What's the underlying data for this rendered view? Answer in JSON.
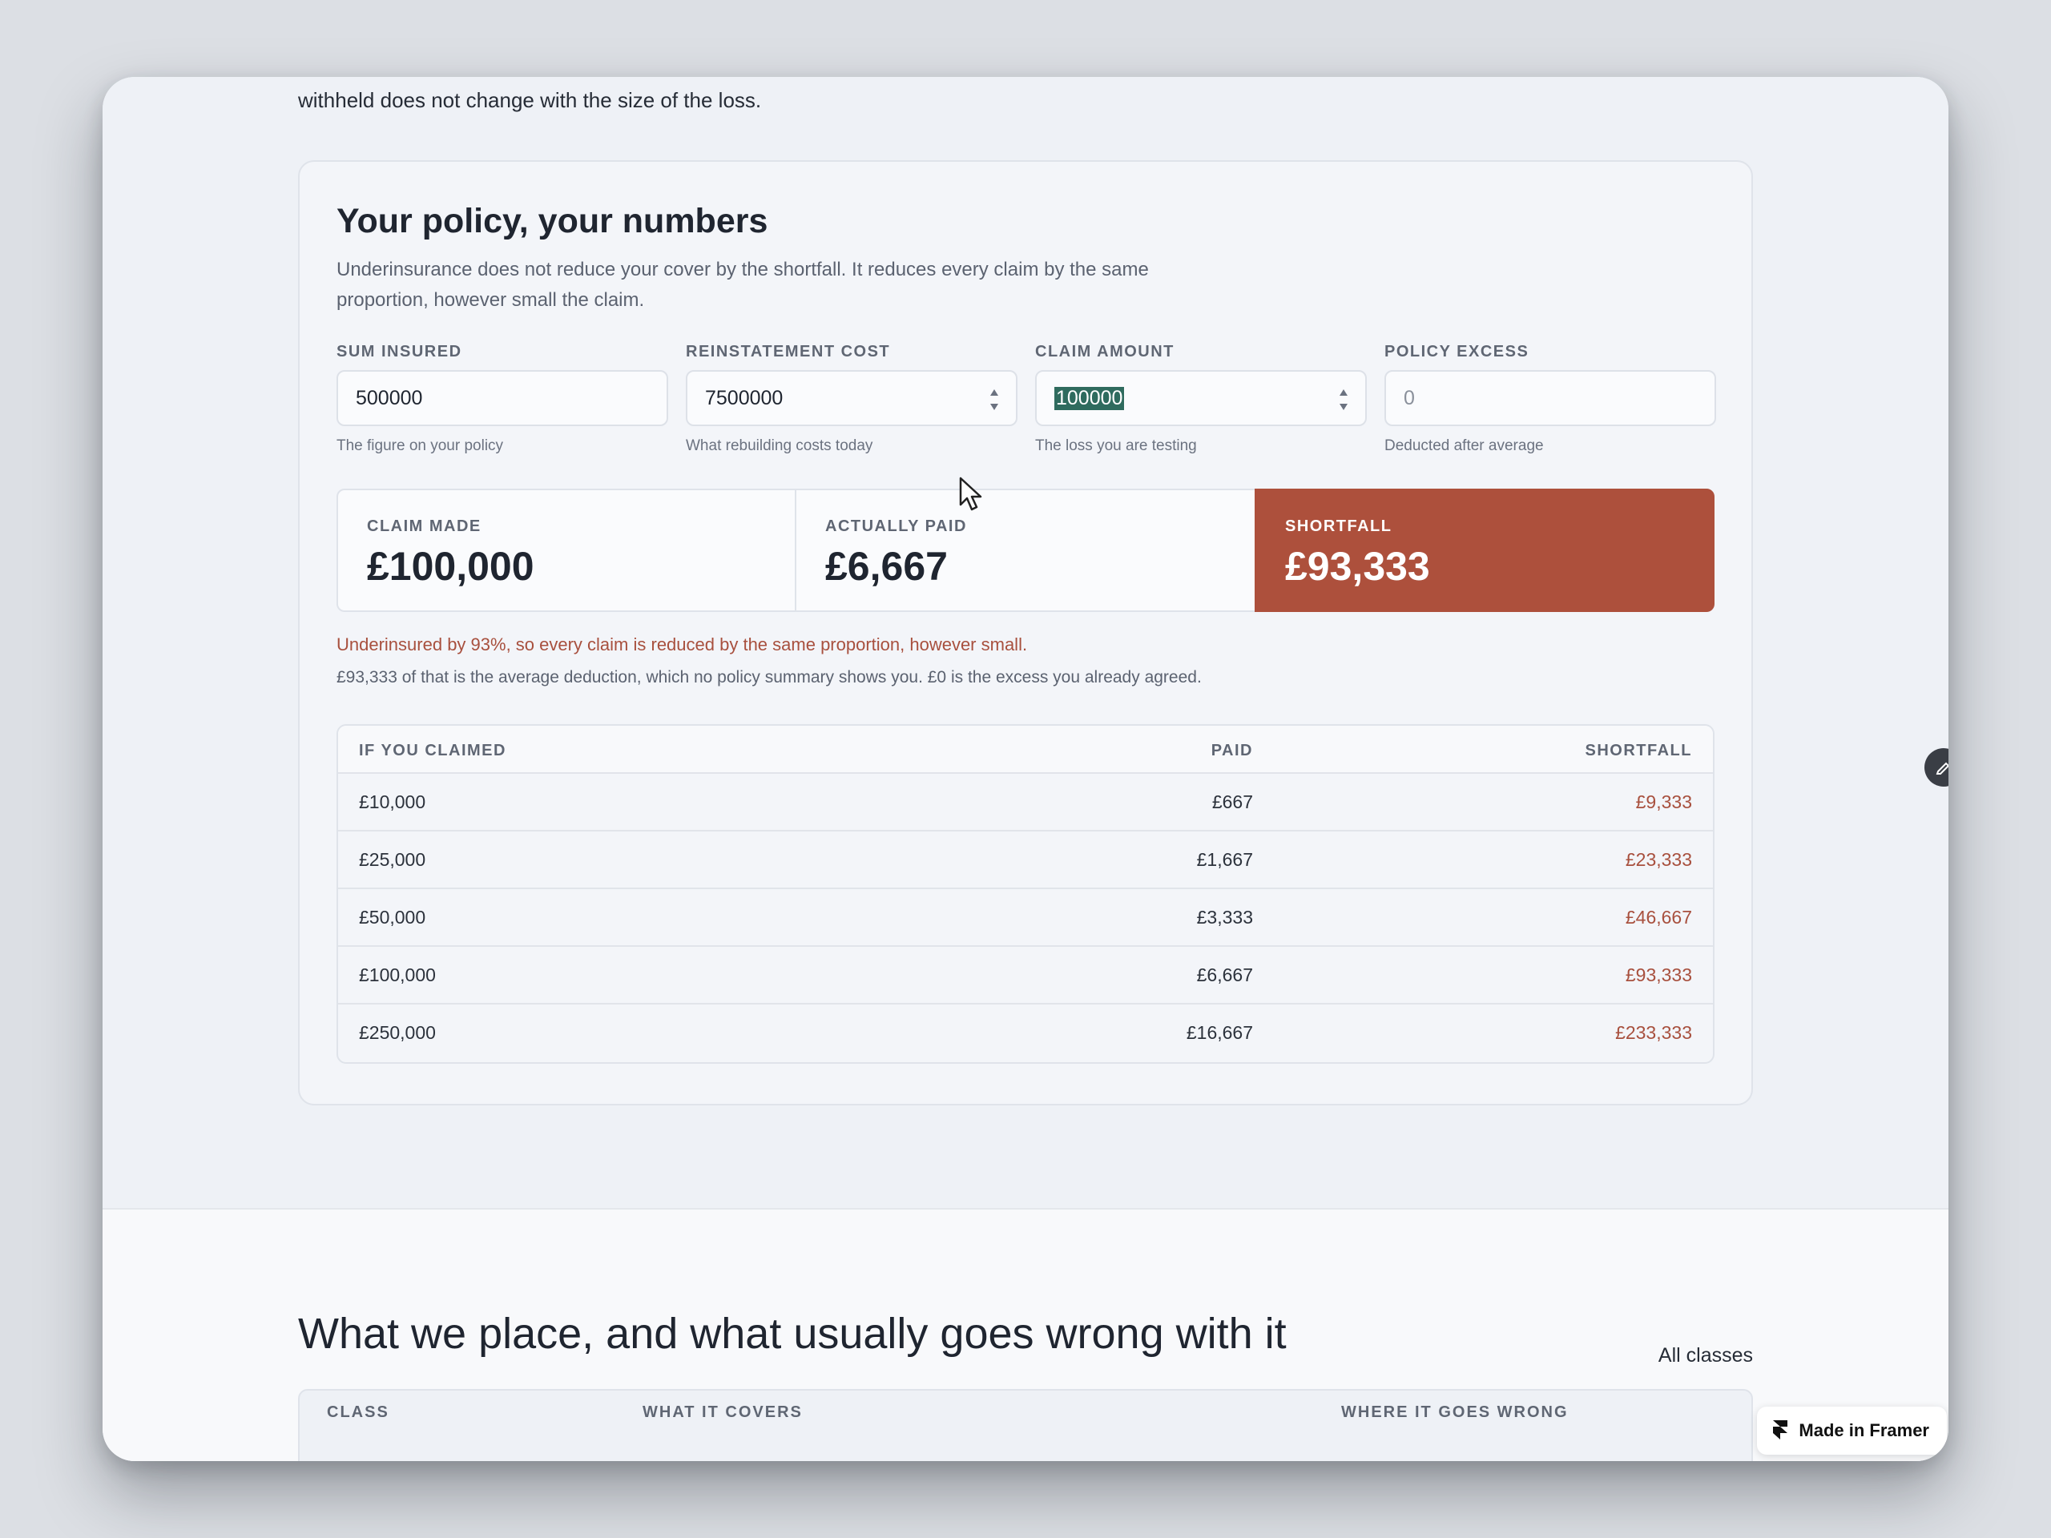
{
  "intro": {
    "tail_text": "withheld does not change with the size of the loss."
  },
  "calculator": {
    "title": "Your policy, your numbers",
    "subtitle": "Underinsurance does not reduce your cover by the shortfall. It reduces every claim by the same proportion, however small the claim.",
    "fields": [
      {
        "label": "SUM INSURED",
        "value": "500000",
        "hint": "The figure on your policy"
      },
      {
        "label": "REINSTATEMENT COST",
        "value": "7500000",
        "hint": "What rebuilding costs today"
      },
      {
        "label": "CLAIM AMOUNT",
        "value": "100000",
        "hint": "The loss you are testing"
      },
      {
        "label": "POLICY EXCESS",
        "value": "0",
        "hint": "Deducted after average"
      }
    ],
    "results": [
      {
        "label": "CLAIM MADE",
        "value": "£100,000"
      },
      {
        "label": "ACTUALLY PAID",
        "value": "£6,667"
      },
      {
        "label": "SHORTFALL",
        "value": "£93,333"
      }
    ],
    "warning": "Underinsured by 93%, so every claim is reduced by the same proportion, however small.",
    "note": "£93,333 of that is the average deduction, which no policy summary shows you. £0 is the excess you already agreed.",
    "table": {
      "headers": [
        "IF YOU CLAIMED",
        "PAID",
        "SHORTFALL"
      ],
      "rows": [
        [
          "£10,000",
          "£667",
          "£9,333"
        ],
        [
          "£25,000",
          "£1,667",
          "£23,333"
        ],
        [
          "£50,000",
          "£3,333",
          "£46,667"
        ],
        [
          "£100,000",
          "£6,667",
          "£93,333"
        ],
        [
          "£250,000",
          "£16,667",
          "£233,333"
        ]
      ]
    }
  },
  "classes_section": {
    "title": "What we place, and what usually goes wrong with it",
    "link": "All classes",
    "headers": [
      "CLASS",
      "WHAT IT COVERS",
      "WHERE IT GOES WRONG"
    ]
  },
  "badge": {
    "label": "Made in Framer",
    "icon": "framer-logo-icon"
  },
  "colors": {
    "accent": "#ad503c",
    "warning_text": "#a8503e",
    "selection": "#2f6b5e"
  }
}
